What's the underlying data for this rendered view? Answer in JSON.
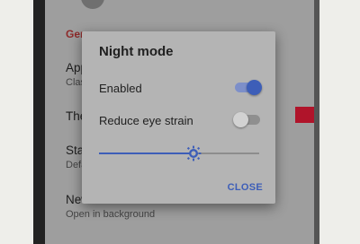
{
  "background_settings": {
    "section_header": "Gen",
    "items": [
      {
        "title": "App",
        "summary": "Clas"
      },
      {
        "title": "The",
        "summary": ""
      },
      {
        "title": "Sta",
        "summary": "Defa"
      },
      {
        "title": "New",
        "summary": "Open in background"
      }
    ]
  },
  "dialog": {
    "title": "Night mode",
    "enabled_label": "Enabled",
    "enabled_state": true,
    "reduce_label": "Reduce eye strain",
    "reduce_state": false,
    "brightness_level": 0.59,
    "close_label": "CLOSE"
  },
  "colors": {
    "accent": "#3d5eb8",
    "section_header": "#8e2a2a",
    "theme_swatch": "#b0142a"
  },
  "icons": {
    "slider_thumb": "brightness-icon"
  }
}
